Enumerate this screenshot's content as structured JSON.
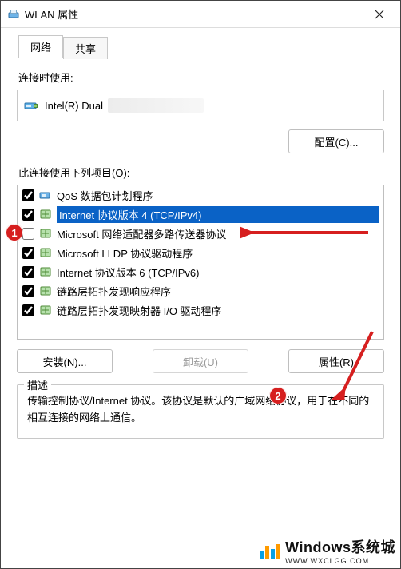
{
  "titlebar": {
    "icon": "network-icon",
    "title": "WLAN 属性",
    "close": "×"
  },
  "tabs": [
    {
      "label": "网络",
      "active": true
    },
    {
      "label": "共享",
      "active": false
    }
  ],
  "adapter": {
    "section_label": "连接时使用:",
    "name_visible": "Intel(R) Dual",
    "configure_btn": "配置(C)..."
  },
  "items_label": "此连接使用下列项目(O):",
  "items": [
    {
      "checked": true,
      "icon": "service-icon",
      "label": "QoS 数据包计划程序",
      "selected": false
    },
    {
      "checked": true,
      "icon": "protocol-icon",
      "label": "Internet 协议版本 4 (TCP/IPv4)",
      "selected": true
    },
    {
      "checked": false,
      "icon": "protocol-icon",
      "label": "Microsoft 网络适配器多路传送器协议",
      "selected": false
    },
    {
      "checked": true,
      "icon": "protocol-icon",
      "label": "Microsoft LLDP 协议驱动程序",
      "selected": false
    },
    {
      "checked": true,
      "icon": "protocol-icon",
      "label": "Internet 协议版本 6 (TCP/IPv6)",
      "selected": false
    },
    {
      "checked": true,
      "icon": "protocol-icon",
      "label": "链路层拓扑发现响应程序",
      "selected": false
    },
    {
      "checked": true,
      "icon": "protocol-icon",
      "label": "链路层拓扑发现映射器 I/O 驱动程序",
      "selected": false
    }
  ],
  "buttons": {
    "install": "安装(N)...",
    "uninstall": "卸载(U)",
    "properties": "属性(R)"
  },
  "description": {
    "legend": "描述",
    "text": "传输控制协议/Internet 协议。该协议是默认的广域网络协议，用于在不同的相互连接的网络上通信。"
  },
  "annotations": {
    "arrow1_color": "#d61f1f",
    "arrow2_color": "#d61f1f",
    "badge1": "1",
    "badge2": "2"
  },
  "watermark": {
    "bar_colors": [
      "#0aa0e6",
      "#ff9b00",
      "#0aa0e6",
      "#ff9b00"
    ],
    "big": "Windows系统城",
    "small": "WWW.WXCLGG.COM"
  }
}
